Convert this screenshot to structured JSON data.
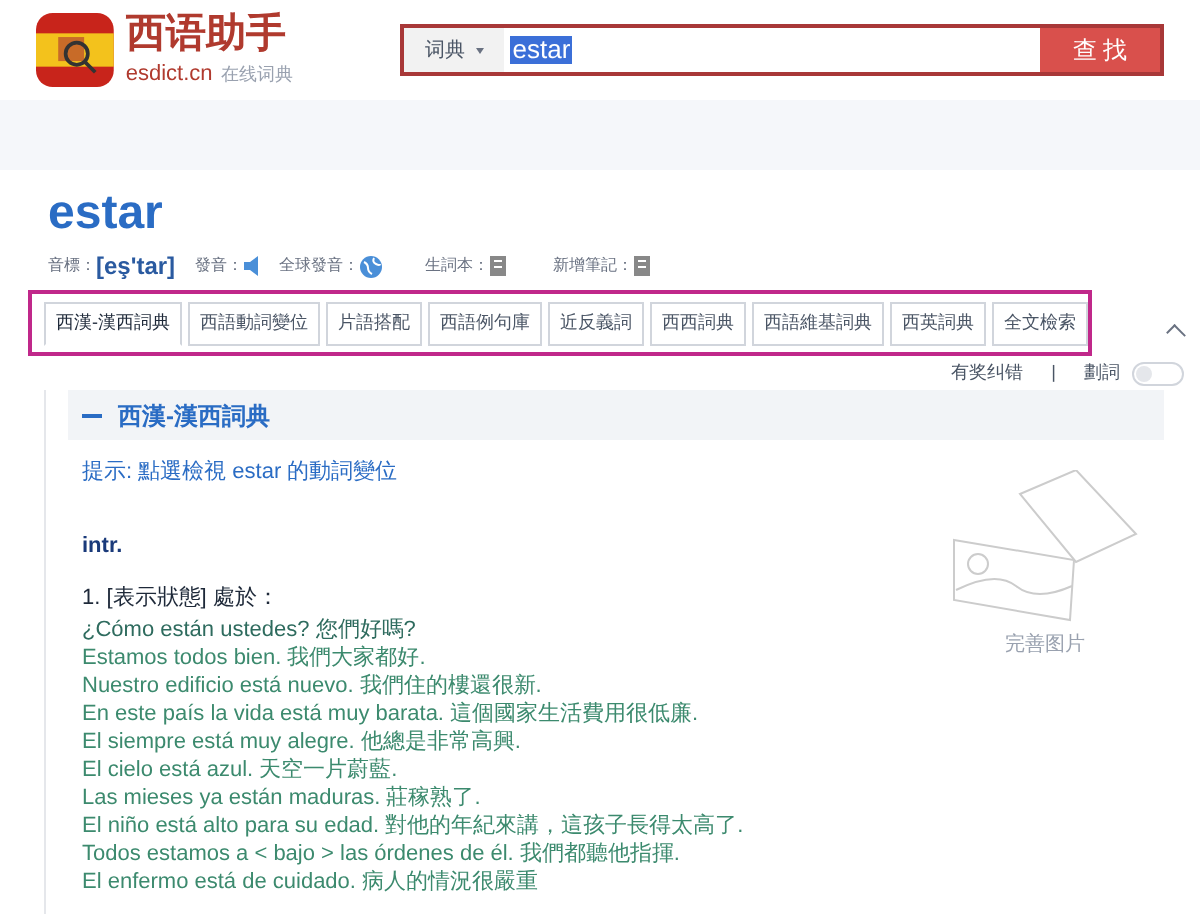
{
  "header": {
    "logo_title": "西语助手",
    "logo_domain": "esdict.cn",
    "logo_tagline": "在线词典",
    "search": {
      "category": "词典",
      "value": "estar",
      "button": "查 找"
    }
  },
  "entry": {
    "word": "estar",
    "phonetic_label": "音標：",
    "phonetic": "[eş'tar]",
    "audio_label": "發音：",
    "global_audio_label": "全球發音：",
    "wordbook_label": "生詞本：",
    "note_label": "新增筆記："
  },
  "tabs": [
    {
      "label": "西漢-漢西詞典",
      "selected": true
    },
    {
      "label": "西語動詞變位",
      "selected": false
    },
    {
      "label": "片語搭配",
      "selected": false
    },
    {
      "label": "西語例句庫",
      "selected": false
    },
    {
      "label": "近反義詞",
      "selected": false
    },
    {
      "label": "西西詞典",
      "selected": false
    },
    {
      "label": "西語維基詞典",
      "selected": false
    },
    {
      "label": "西英詞典",
      "selected": false
    },
    {
      "label": "全文檢索",
      "selected": false
    }
  ],
  "options": {
    "report": "有奖纠错",
    "divider": "|",
    "split_label": "劃詞",
    "split_on": false
  },
  "section": {
    "title": "西漢-漢西詞典",
    "expanded": true,
    "hint": "提示: 點選檢視 estar 的動詞變位",
    "pos": "intr.",
    "sense": "1. [表示狀態] 處於：",
    "examples": [
      {
        "es": "¿Cómo están ustedes?",
        "zh": "您們好嗎?"
      },
      {
        "es": "Estamos todos bien.",
        "zh": "我們大家都好."
      },
      {
        "es": "Nuestro edificio está nuevo.",
        "zh": "我們住的樓還很新."
      },
      {
        "es": "En este país la vida está muy barata.",
        "zh": "這個國家生活費用很低廉."
      },
      {
        "es": "El siempre está muy alegre.",
        "zh": "他總是非常高興."
      },
      {
        "es": "El cielo está azul.",
        "zh": "天空一片蔚藍."
      },
      {
        "es": "Las mieses ya están maduras.",
        "zh": "莊稼熟了."
      },
      {
        "es": "El niño está alto para su edad.",
        "zh": "對他的年紀來講，這孩子長得太高了."
      },
      {
        "es": "Todos estamos a < bajo > las órdenes de él.",
        "zh": "我們都聽他指揮."
      },
      {
        "es": "El enfermo está de cuidado.",
        "zh": "病人的情況很嚴重"
      }
    ],
    "image_label": "完善图片"
  }
}
